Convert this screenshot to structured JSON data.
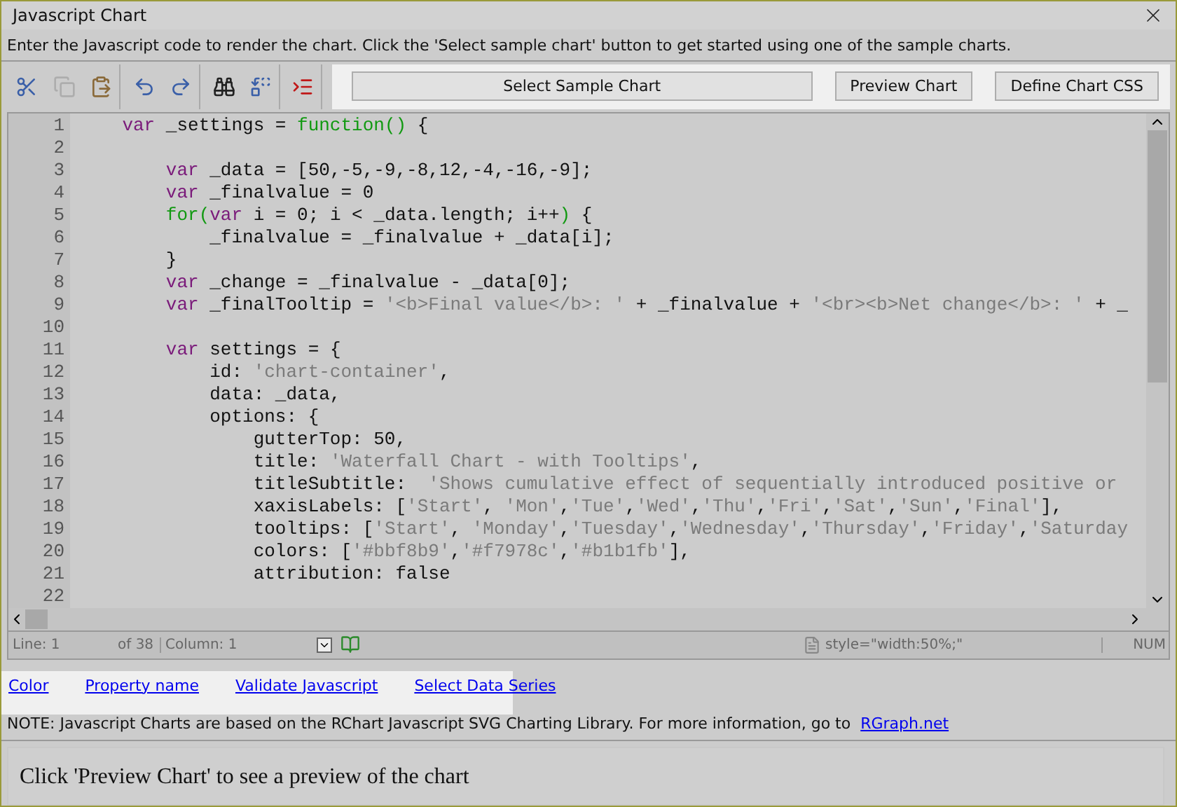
{
  "window": {
    "title": "Javascript Chart"
  },
  "instruction": "Enter the Javascript code to render the chart. Click the 'Select sample chart' button to get started using one of the sample charts.",
  "toolbar": {
    "icons": [
      {
        "kind": "cut",
        "disabled": false
      },
      {
        "kind": "copy",
        "disabled": true
      },
      {
        "kind": "paste",
        "disabled": false
      },
      {
        "kind": "undo",
        "disabled": false
      },
      {
        "kind": "redo",
        "disabled": false
      },
      {
        "kind": "find",
        "disabled": false
      },
      {
        "kind": "replace",
        "disabled": false
      },
      {
        "kind": "indent",
        "disabled": false
      }
    ],
    "buttons": [
      {
        "label": "Select Sample Chart",
        "kind": "wide"
      },
      {
        "label": "Preview Chart",
        "kind": "normal"
      },
      {
        "label": "Define Chart CSS",
        "kind": "normal"
      }
    ]
  },
  "editor": {
    "lines": [
      {
        "number": "1",
        "tokens": [
          {
            "kind": "kw",
            "text": "    var"
          },
          {
            "kind": "plain",
            "text": " _settings = "
          },
          {
            "kind": "fn",
            "text": "function()"
          },
          {
            "kind": "plain",
            "text": " {"
          }
        ]
      },
      {
        "number": "2"
      },
      {
        "number": "3",
        "tokens": [
          {
            "kind": "kw",
            "text": "        var"
          },
          {
            "kind": "plain",
            "text": " _data = [50,-5,-9,-8,12,-4,-16,-9];"
          }
        ]
      },
      {
        "number": "4",
        "tokens": [
          {
            "kind": "kw",
            "text": "        var"
          },
          {
            "kind": "plain",
            "text": " _finalvalue = 0"
          }
        ]
      },
      {
        "number": "5",
        "tokens": [
          {
            "kind": "fn",
            "text": "        for("
          },
          {
            "kind": "kw",
            "text": "var"
          },
          {
            "kind": "plain",
            "text": " i = 0; i < _data.length; i++"
          },
          {
            "kind": "fn",
            "text": ")"
          },
          {
            "kind": "plain",
            "text": " {"
          }
        ]
      },
      {
        "number": "6",
        "tokens": [
          {
            "kind": "plain",
            "text": "            _finalvalue = _finalvalue + _data[i];"
          }
        ]
      },
      {
        "number": "7",
        "tokens": [
          {
            "kind": "plain",
            "text": "        }"
          }
        ]
      },
      {
        "number": "8",
        "tokens": [
          {
            "kind": "kw",
            "text": "        var"
          },
          {
            "kind": "plain",
            "text": " _change = _finalvalue - _data[0];"
          }
        ]
      },
      {
        "number": "9",
        "tokens": [
          {
            "kind": "kw",
            "text": "        var"
          },
          {
            "kind": "plain",
            "text": " _finalTooltip = "
          },
          {
            "kind": "str",
            "text": "'<b>Final value</b>: '"
          },
          {
            "kind": "plain",
            "text": " + _finalvalue + "
          },
          {
            "kind": "str",
            "text": "'<br><b>Net change</b>: '"
          },
          {
            "kind": "plain",
            "text": " + _"
          }
        ]
      },
      {
        "number": "10"
      },
      {
        "number": "11",
        "tokens": [
          {
            "kind": "kw",
            "text": "        var"
          },
          {
            "kind": "plain",
            "text": " settings = {"
          }
        ]
      },
      {
        "number": "12",
        "tokens": [
          {
            "kind": "plain",
            "text": "            id: "
          },
          {
            "kind": "str",
            "text": "'chart-container'"
          },
          {
            "kind": "plain",
            "text": ","
          }
        ]
      },
      {
        "number": "13",
        "tokens": [
          {
            "kind": "plain",
            "text": "            data: _data,"
          }
        ]
      },
      {
        "number": "14",
        "tokens": [
          {
            "kind": "plain",
            "text": "            options: {"
          }
        ]
      },
      {
        "number": "15",
        "tokens": [
          {
            "kind": "plain",
            "text": "                gutterTop: 50,"
          }
        ]
      },
      {
        "number": "16",
        "tokens": [
          {
            "kind": "plain",
            "text": "                title: "
          },
          {
            "kind": "str",
            "text": "'Waterfall Chart - with Tooltips'"
          },
          {
            "kind": "plain",
            "text": ","
          }
        ]
      },
      {
        "number": "17",
        "tokens": [
          {
            "kind": "plain",
            "text": "                titleSubtitle:  "
          },
          {
            "kind": "str",
            "text": "'Shows cumulative effect of sequentially introduced positive or"
          }
        ]
      },
      {
        "number": "18",
        "tokens": [
          {
            "kind": "plain",
            "text": "                xaxisLabels: ["
          },
          {
            "kind": "str",
            "text": "'Start'"
          },
          {
            "kind": "plain",
            "text": ", "
          },
          {
            "kind": "str",
            "text": "'Mon'"
          },
          {
            "kind": "plain",
            "text": ","
          },
          {
            "kind": "str",
            "text": "'Tue'"
          },
          {
            "kind": "plain",
            "text": ","
          },
          {
            "kind": "str",
            "text": "'Wed'"
          },
          {
            "kind": "plain",
            "text": ","
          },
          {
            "kind": "str",
            "text": "'Thu'"
          },
          {
            "kind": "plain",
            "text": ","
          },
          {
            "kind": "str",
            "text": "'Fri'"
          },
          {
            "kind": "plain",
            "text": ","
          },
          {
            "kind": "str",
            "text": "'Sat'"
          },
          {
            "kind": "plain",
            "text": ","
          },
          {
            "kind": "str",
            "text": "'Sun'"
          },
          {
            "kind": "plain",
            "text": ","
          },
          {
            "kind": "str",
            "text": "'Final'"
          },
          {
            "kind": "plain",
            "text": "],"
          }
        ]
      },
      {
        "number": "19",
        "tokens": [
          {
            "kind": "plain",
            "text": "                tooltips: ["
          },
          {
            "kind": "str",
            "text": "'Start'"
          },
          {
            "kind": "plain",
            "text": ", "
          },
          {
            "kind": "str",
            "text": "'Monday'"
          },
          {
            "kind": "plain",
            "text": ","
          },
          {
            "kind": "str",
            "text": "'Tuesday'"
          },
          {
            "kind": "plain",
            "text": ","
          },
          {
            "kind": "str",
            "text": "'Wednesday'"
          },
          {
            "kind": "plain",
            "text": ","
          },
          {
            "kind": "str",
            "text": "'Thursday'"
          },
          {
            "kind": "plain",
            "text": ","
          },
          {
            "kind": "str",
            "text": "'Friday'"
          },
          {
            "kind": "plain",
            "text": ","
          },
          {
            "kind": "str",
            "text": "'Saturday"
          }
        ]
      },
      {
        "number": "20",
        "tokens": [
          {
            "kind": "plain",
            "text": "                colors: ["
          },
          {
            "kind": "str",
            "text": "'#bbf8b9'"
          },
          {
            "kind": "plain",
            "text": ","
          },
          {
            "kind": "str",
            "text": "'#f7978c'"
          },
          {
            "kind": "plain",
            "text": ","
          },
          {
            "kind": "str",
            "text": "'#b1b1fb'"
          },
          {
            "kind": "plain",
            "text": "],"
          }
        ]
      },
      {
        "number": "21",
        "tokens": [
          {
            "kind": "plain",
            "text": "                attribution: false"
          }
        ]
      },
      {
        "number": "22"
      }
    ]
  },
  "status_bar": {
    "line": "Line: 1",
    "of": "of 38",
    "column": "Column: 1",
    "attribute": "style=\"width:50%;\"",
    "mode": "NUM"
  },
  "links": [
    "Color",
    "Property name",
    "Validate Javascript",
    "Select Data Series"
  ],
  "note": {
    "text": "NOTE: Javascript Charts are based on the RChart Javascript SVG Charting Library. For more information, go to",
    "link": "RGraph.net"
  },
  "preview": "Click 'Preview Chart' to see a preview of the chart"
}
